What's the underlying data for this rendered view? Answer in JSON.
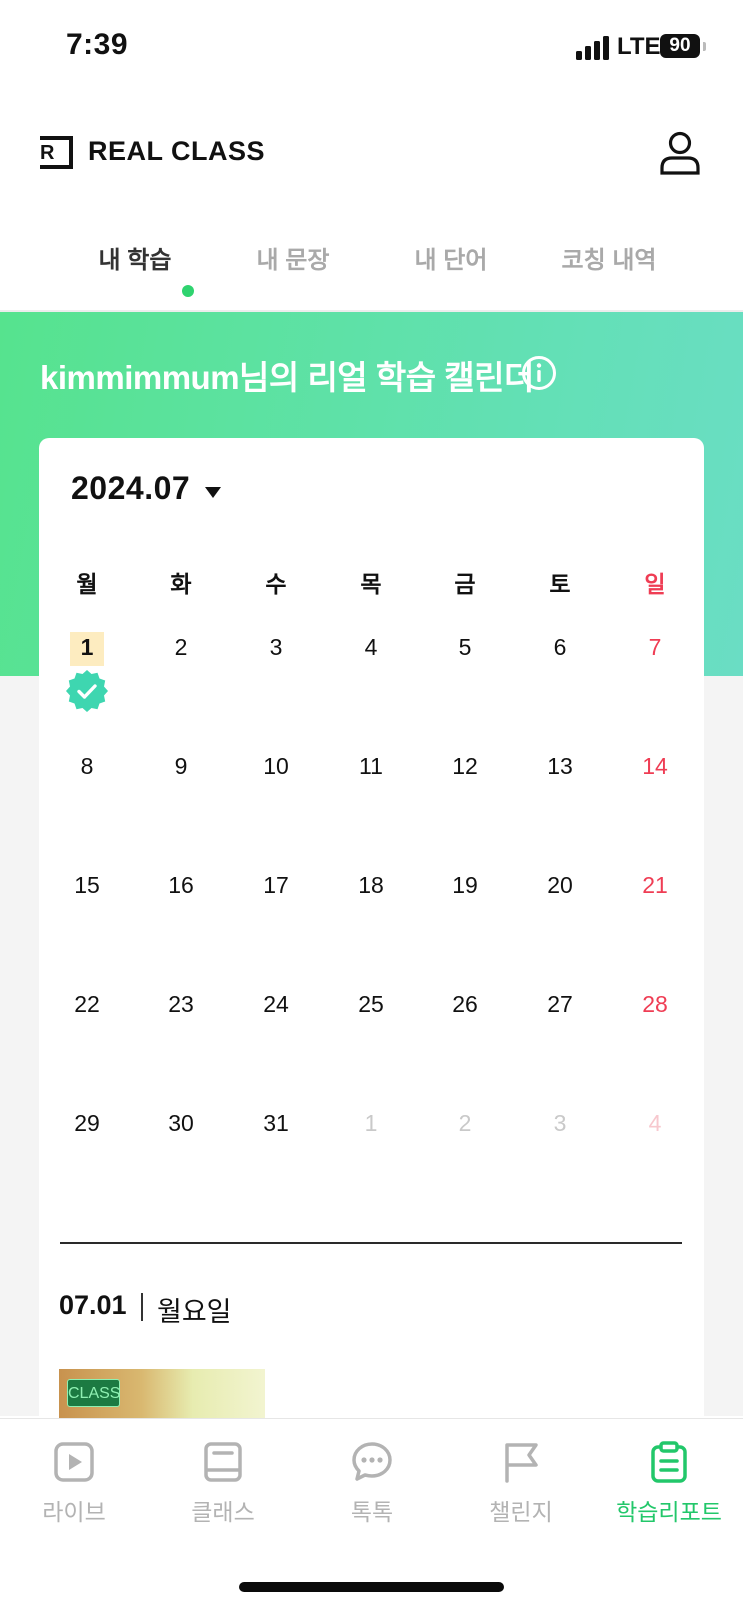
{
  "status_bar": {
    "time": "7:39",
    "network": "LTE",
    "battery": "90"
  },
  "header": {
    "logo_mark": "R",
    "logo_text": "REAL CLASS",
    "profile_icon": "person-icon"
  },
  "tabs": [
    {
      "label": "내 학습",
      "active": true
    },
    {
      "label": "내 문장",
      "active": false
    },
    {
      "label": "내 단어",
      "active": false
    },
    {
      "label": "코칭 내역",
      "active": false
    }
  ],
  "hero": {
    "title": "kimmimmum님의 리얼 학습 캘린더",
    "info_icon": "info-icon"
  },
  "calendar": {
    "month_label": "2024.07",
    "weekdays": [
      "월",
      "화",
      "수",
      "목",
      "금",
      "토",
      "일"
    ],
    "weeks": [
      [
        "1",
        "2",
        "3",
        "4",
        "5",
        "6",
        "7"
      ],
      [
        "8",
        "9",
        "10",
        "11",
        "12",
        "13",
        "14"
      ],
      [
        "15",
        "16",
        "17",
        "18",
        "19",
        "20",
        "21"
      ],
      [
        "22",
        "23",
        "24",
        "25",
        "26",
        "27",
        "28"
      ],
      [
        "29",
        "30",
        "31",
        "1",
        "2",
        "3",
        "4"
      ]
    ],
    "highlighted_day": "1",
    "completed_days": [
      "1"
    ]
  },
  "detail": {
    "date": "07.01",
    "weekday": "월요일"
  },
  "lesson": {
    "badge": "CLASS"
  },
  "bottom_nav": [
    {
      "label": "라이브",
      "icon": "play-icon",
      "active": false
    },
    {
      "label": "클래스",
      "icon": "book-icon",
      "active": false
    },
    {
      "label": "톡톡",
      "icon": "chat-bubble-icon",
      "active": false
    },
    {
      "label": "챌린지",
      "icon": "flag-icon",
      "active": false
    },
    {
      "label": "학습리포트",
      "icon": "clipboard-icon",
      "active": true
    }
  ],
  "colors": {
    "accent": "#22c76a",
    "sunday": "#ef3d54",
    "highlight": "#fdecc0",
    "check": "#3ed6b0"
  }
}
